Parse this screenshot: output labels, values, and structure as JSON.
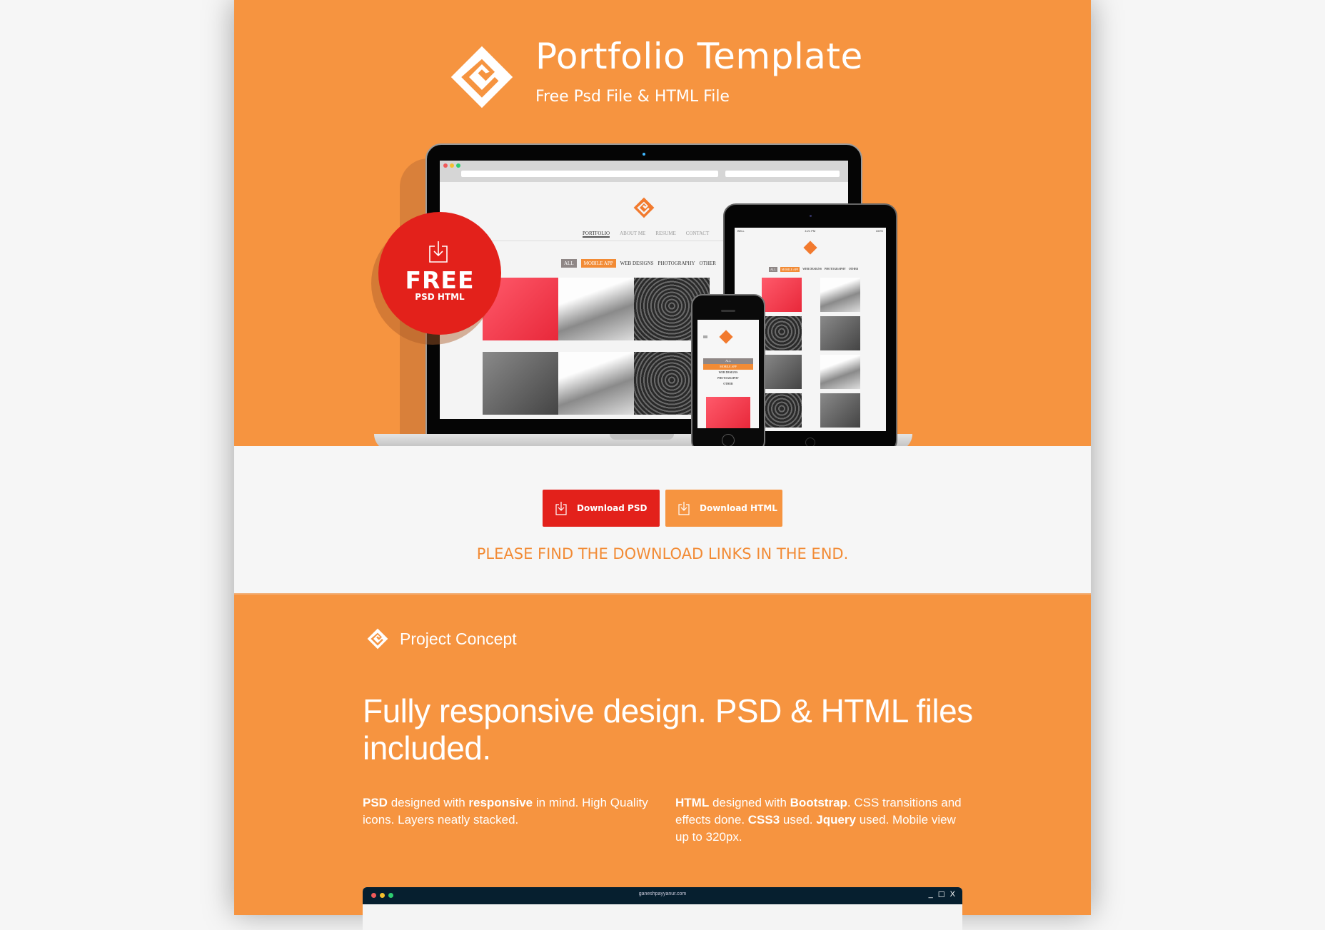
{
  "header": {
    "title": "Portfolio Template",
    "subtitle": "Free Psd File & HTML File",
    "logo_icon": "g-diamond-logo-icon"
  },
  "mockup": {
    "badge": {
      "title": "FREE",
      "subtitle": "PSD HTML",
      "icon": "download-icon"
    },
    "desktop_nav": [
      "PORTFOLIO",
      "ABOUT ME",
      "RESUME",
      "CONTACT"
    ],
    "filters": [
      "ALL",
      "MOBILE APP",
      "WEB DESIGNS",
      "PHOTOGRAPHY",
      "OTHER"
    ],
    "phone_menu": [
      "ALL",
      "MOBILE APP",
      "WEB DESIGNS",
      "PHOTOGRAPHY",
      "OTHER"
    ],
    "status_time": "4:21 PM",
    "status_battery": "100%",
    "status_carrier": "BELL"
  },
  "downloads": {
    "psd_label": "Download PSD",
    "html_label": "Download HTML",
    "notice": "PLEASE FIND THE DOWNLOAD LINKS IN THE END.",
    "psd_color": "#e3211b",
    "html_color": "#f69440"
  },
  "concept": {
    "section_title": "Project Concept",
    "heading": "Fully responsive design. PSD & HTML files included.",
    "psd_para": {
      "b1": "PSD",
      "t1": " designed with ",
      "b2": "responsive",
      "t2": " in mind. High Quality icons. Layers neatly stacked."
    },
    "html_para": {
      "b1": "HTML",
      "t1": " designed with ",
      "b2": "Bootstrap",
      "t2": ". CSS transitions and effects done. ",
      "b3": "CSS3",
      "t3": " used. ",
      "b4": "Jquery",
      "t4": " used. Mobile view up to 320px."
    },
    "window_url": "ganeshpayyanur.com",
    "window_controls": {
      "minimize": "_",
      "maximize": "☐",
      "close": "X"
    }
  },
  "colors": {
    "brand_orange": "#f69440",
    "brand_red": "#e3211b",
    "window_bar": "#061f2f"
  }
}
